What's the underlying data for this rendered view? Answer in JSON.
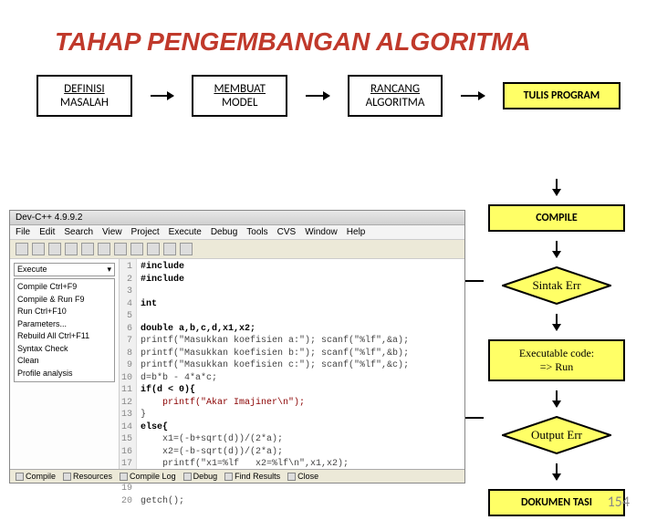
{
  "title": "TAHAP PENGEMBANGAN ALGORITMA",
  "page_number": "154",
  "steps": {
    "definisi_l1": "DEFINISI",
    "definisi_l2": "MASALAH",
    "membuat_l1": "MEMBUAT",
    "membuat_l2": "MODEL",
    "rancang_l1": "RANCANG",
    "rancang_l2": "ALGORITMA",
    "tulis": "TULIS PROGRAM",
    "compile": "COMPILE",
    "sintak_err": "Sintak Err",
    "exec_l1": "Executable code:",
    "exec_l2": "=> Run",
    "output_err": "Output Err",
    "dokumentasi": "DOKUMEN TASI"
  },
  "ide": {
    "title": "Dev-C++ 4.9.9.2",
    "menu": [
      "File",
      "Edit",
      "Search",
      "View",
      "Project",
      "Execute",
      "Debug",
      "Tools",
      "CVS",
      "Window",
      "Help"
    ],
    "exec_dropdown_header": "Execute",
    "exec_items": [
      "Compile                  Ctrl+F9",
      "Compile & Run       F9",
      "Run                         Ctrl+F10",
      "Parameters...",
      "Rebuild All            Ctrl+F11",
      "Syntax Check",
      "Clean",
      "Profile analysis"
    ],
    "status": [
      "Compile",
      "Resources",
      "Compile Log",
      "Debug",
      "Find Results",
      "Close"
    ],
    "code_lines": [
      "#include",
      "#include",
      "",
      "int",
      "",
      "double a,b,c,d,x1,x2;",
      "printf(\"Masukkan koefisien a:\"); scanf(\"%lf\",&a);",
      "printf(\"Masukkan koefisien b:\"); scanf(\"%lf\",&b);",
      "printf(\"Masukkan koefisien c:\"); scanf(\"%lf\",&c);",
      "d=b*b - 4*a*c;",
      "if(d < 0){",
      "    printf(\"Akar Imajiner\\n\");",
      "}",
      "else{",
      "    x1=(-b+sqrt(d))/(2*a);",
      "    x2=(-b-sqrt(d))/(2*a);",
      "    printf(\"x1=%lf   x2=%lf\\n\",x1,x2);",
      "}",
      "",
      "getch();"
    ]
  }
}
